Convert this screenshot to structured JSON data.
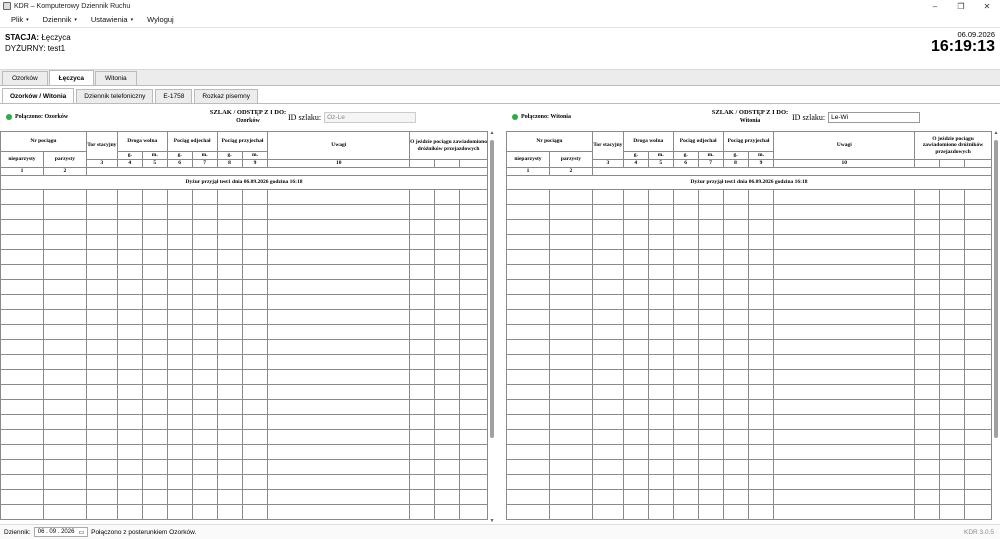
{
  "window": {
    "title": "KDR – Komputerowy Dziennik Ruchu",
    "minimize": "–",
    "maximize": "❐",
    "close": "✕"
  },
  "menu": [
    {
      "label": "Plik",
      "caret": "▾"
    },
    {
      "label": "Dziennik",
      "caret": "▾"
    },
    {
      "label": "Ustawienia",
      "caret": "▾"
    },
    {
      "label": "Wyloguj",
      "caret": ""
    }
  ],
  "header": {
    "station_label": "STACJA:",
    "station_value": "Łęczyca",
    "duty_label": "DYŻURNY:",
    "duty_value": "test1",
    "date": "06.09.2026",
    "time": "16:19:13"
  },
  "station_tabs": [
    "Ozorków",
    "Łęczyca",
    "Witonia"
  ],
  "active_station_tab": "Łęczyca",
  "sub_tabs": [
    "Ozorków / Witonia",
    "Dziennik telefoniczny",
    "E-1758",
    "Rozkaz pisemny"
  ],
  "active_sub_tab": "Ozorków / Witonia",
  "columns": {
    "nr_pociagu": "Nr pociągu",
    "nieparzysty": "nieparzysty",
    "parzysty": "parzysty",
    "tor": "Tor stacyjny",
    "droga": "Droga wolna",
    "odjechal": "Pociąg odjechał",
    "przyjechal": "Pociąg przyjechał",
    "g": "g.",
    "m": "m.",
    "uwagi": "Uwagi",
    "o_jezdzie": "O jeździe pociągu zawiadomiono dróżników przejazdowych",
    "n1": "1",
    "n2": "2",
    "n3": "3",
    "n4": "4",
    "n5": "5",
    "n6": "6",
    "n7": "7",
    "n8": "8",
    "n9": "9",
    "n10": "10"
  },
  "left_panel": {
    "status": "Połączono: Ozorków",
    "szlak_title": "SZLAK / ODSTĘP Z I DO:",
    "szlak_name": "Ozorków",
    "id_label": "ID szlaku:",
    "id_value": "Oz-Le",
    "note": "Dyżur przyjął test1 dnia 06.09.2026 godzina 16:18"
  },
  "right_panel": {
    "status": "Połączono: Witonia",
    "szlak_title": "SZLAK / ODSTĘP Z I DO:",
    "szlak_name": "Witonia",
    "id_label": "ID szlaku:",
    "id_value": "Le-Wi",
    "note": "Dyżur przyjął test1 dnia 06.09.2026 godzina 16:18"
  },
  "footer": {
    "label": "Dziennik:",
    "date": "06 . 09 . 2026",
    "status": "Połączono z posterunkiem Ozorków.",
    "version": "KDR 3.0.5"
  },
  "colors": {
    "connected": "#2eaa4a"
  }
}
